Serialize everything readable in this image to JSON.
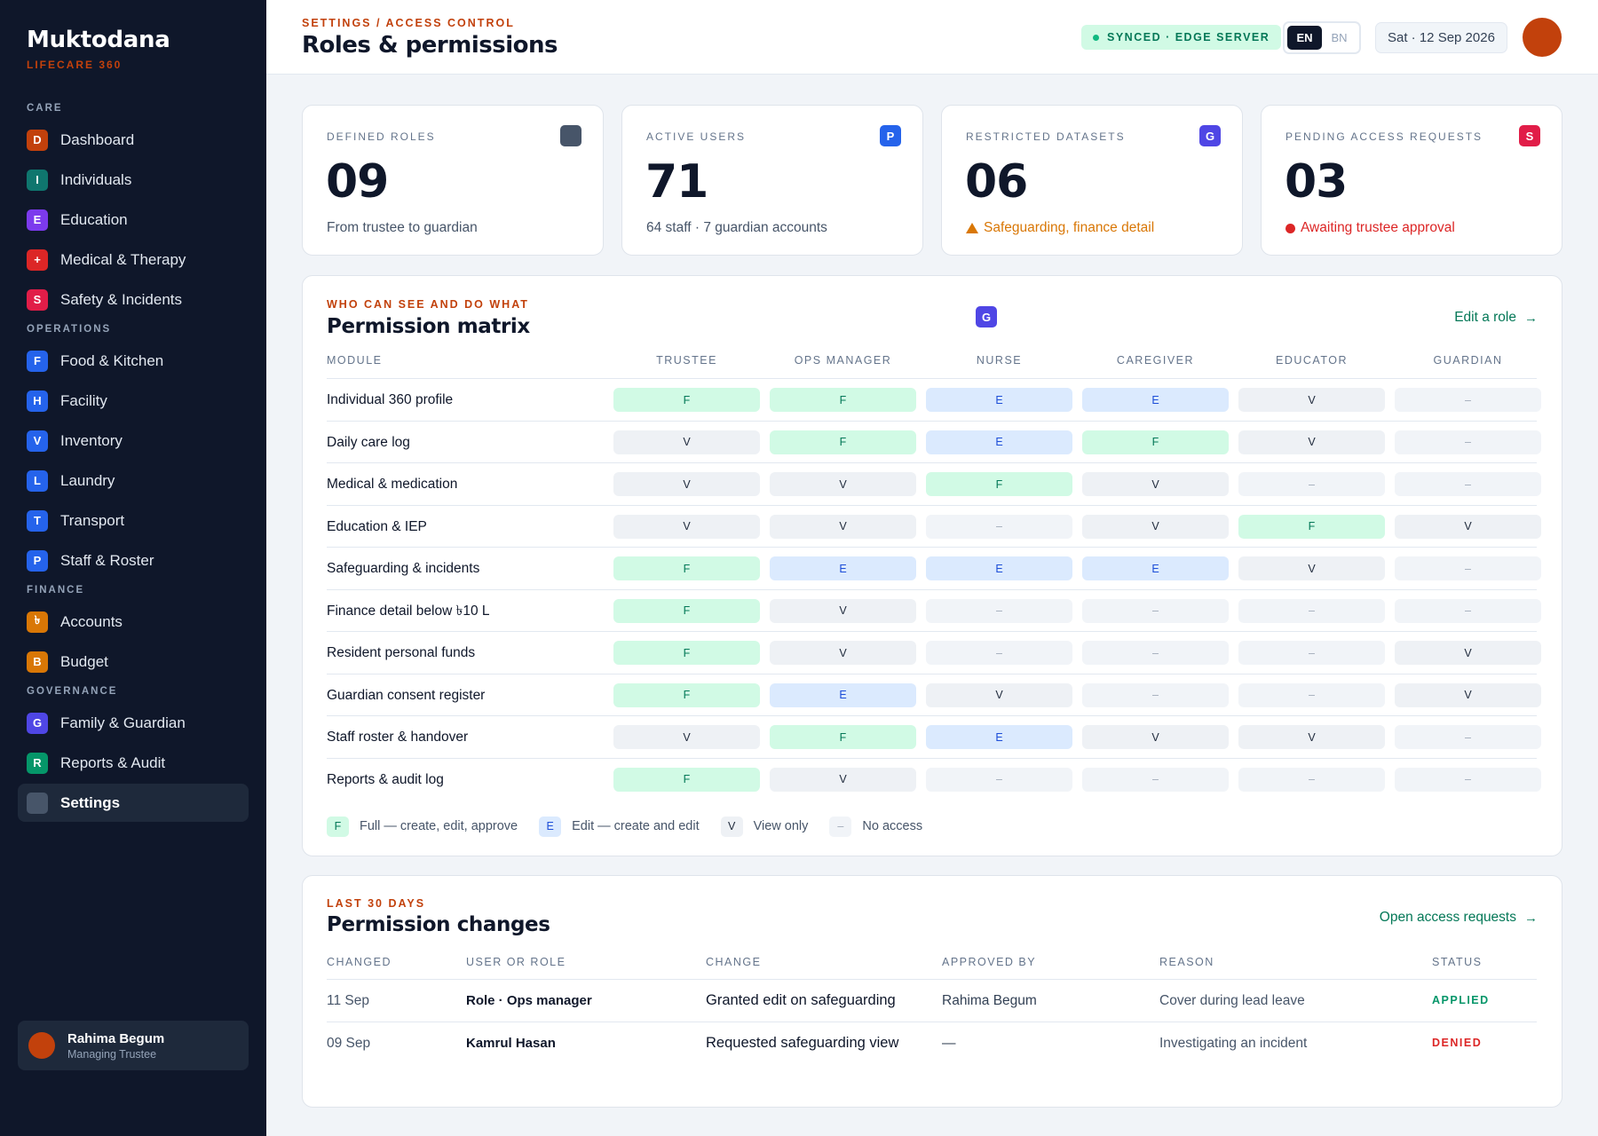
{
  "brand": {
    "name": "Muktodana",
    "subtitle": "LIFECARE 360"
  },
  "sidebar": {
    "sections": [
      {
        "label": "CARE",
        "items": [
          {
            "letter": "D",
            "label": "Dashboard",
            "color": "#c2410c"
          },
          {
            "letter": "I",
            "label": "Individuals",
            "color": "#0f766e"
          },
          {
            "letter": "E",
            "label": "Education",
            "color": "#7c3aed"
          },
          {
            "letter": "+",
            "label": "Medical & Therapy",
            "color": "#dc2626"
          },
          {
            "letter": "S",
            "label": "Safety & Incidents",
            "color": "#e11d48"
          }
        ]
      },
      {
        "label": "OPERATIONS",
        "items": [
          {
            "letter": "F",
            "label": "Food & Kitchen",
            "color": "#2563eb"
          },
          {
            "letter": "H",
            "label": "Facility",
            "color": "#2563eb"
          },
          {
            "letter": "V",
            "label": "Inventory",
            "color": "#2563eb"
          },
          {
            "letter": "L",
            "label": "Laundry",
            "color": "#2563eb"
          },
          {
            "letter": "T",
            "label": "Transport",
            "color": "#2563eb"
          },
          {
            "letter": "P",
            "label": "Staff & Roster",
            "color": "#2563eb"
          }
        ]
      },
      {
        "label": "FINANCE",
        "items": [
          {
            "letter": "৳",
            "label": "Accounts",
            "color": "#d97706"
          },
          {
            "letter": "B",
            "label": "Budget",
            "color": "#d97706"
          }
        ]
      },
      {
        "label": "GOVERNANCE",
        "items": [
          {
            "letter": "G",
            "label": "Family & Guardian",
            "color": "#4f46e5"
          },
          {
            "letter": "R",
            "label": "Reports & Audit",
            "color": "#059669"
          },
          {
            "letter": "",
            "label": "Settings",
            "color": "#475569",
            "active": true
          }
        ]
      }
    ],
    "user": {
      "name": "Rahima Begum",
      "role": "Managing Trustee"
    }
  },
  "header": {
    "breadcrumb": "SETTINGS / ACCESS CONTROL",
    "title": "Roles & permissions",
    "sync_status": "SYNCED · EDGE SERVER",
    "languages": [
      "EN",
      "BN"
    ],
    "active_language": "EN",
    "date": "Sat · 12 Sep 2026"
  },
  "stats": [
    {
      "label": "DEFINED ROLES",
      "value": "09",
      "note": "From trustee to guardian",
      "badge": "",
      "badge_color": "#475569",
      "note_type": "plain"
    },
    {
      "label": "ACTIVE USERS",
      "value": "71",
      "note": "64 staff · 7 guardian accounts",
      "badge": "P",
      "badge_color": "#2563eb",
      "note_type": "plain"
    },
    {
      "label": "RESTRICTED DATASETS",
      "value": "06",
      "note": "Safeguarding, finance detail",
      "badge": "G",
      "badge_color": "#4f46e5",
      "note_type": "warn"
    },
    {
      "label": "PENDING ACCESS REQUESTS",
      "value": "03",
      "note": "Awaiting trustee approval",
      "badge": "S",
      "badge_color": "#e11d48",
      "note_type": "danger"
    }
  ],
  "matrix": {
    "eyebrow": "WHO CAN SEE AND DO WHAT",
    "title": "Permission matrix",
    "badge": "G",
    "link": "Edit a role",
    "module_header": "MODULE",
    "roles": [
      "TRUSTEE",
      "OPS MANAGER",
      "NURSE",
      "CAREGIVER",
      "EDUCATOR",
      "GUARDIAN"
    ],
    "rows": [
      {
        "module": "Individual 360 profile",
        "cells": [
          "F",
          "F",
          "E",
          "E",
          "V",
          "–"
        ]
      },
      {
        "module": "Daily care log",
        "cells": [
          "V",
          "F",
          "E",
          "F",
          "V",
          "–"
        ]
      },
      {
        "module": "Medical & medication",
        "cells": [
          "V",
          "V",
          "F",
          "V",
          "–",
          "–"
        ]
      },
      {
        "module": "Education & IEP",
        "cells": [
          "V",
          "V",
          "–",
          "V",
          "F",
          "V"
        ]
      },
      {
        "module": "Safeguarding & incidents",
        "cells": [
          "F",
          "E",
          "E",
          "E",
          "V",
          "–"
        ]
      },
      {
        "module": "Finance detail below ৳10 L",
        "cells": [
          "F",
          "V",
          "–",
          "–",
          "–",
          "–"
        ]
      },
      {
        "module": "Resident personal funds",
        "cells": [
          "F",
          "V",
          "–",
          "–",
          "–",
          "V"
        ]
      },
      {
        "module": "Guardian consent register",
        "cells": [
          "F",
          "E",
          "V",
          "–",
          "–",
          "V"
        ]
      },
      {
        "module": "Staff roster & handover",
        "cells": [
          "V",
          "F",
          "E",
          "V",
          "V",
          "–"
        ]
      },
      {
        "module": "Reports & audit log",
        "cells": [
          "F",
          "V",
          "–",
          "–",
          "–",
          "–"
        ]
      }
    ],
    "legend": [
      {
        "code": "F",
        "text": "Full — create, edit, approve"
      },
      {
        "code": "E",
        "text": "Edit — create and edit"
      },
      {
        "code": "V",
        "text": "View only"
      },
      {
        "code": "–",
        "text": "No access"
      }
    ]
  },
  "changes": {
    "eyebrow": "LAST 30 DAYS",
    "title": "Permission changes",
    "link": "Open access requests",
    "headers": [
      "CHANGED",
      "USER OR ROLE",
      "CHANGE",
      "APPROVED BY",
      "REASON",
      "STATUS"
    ],
    "rows": [
      {
        "date": "11 Sep",
        "user": "Role · Ops manager",
        "change": "Granted edit on safeguarding",
        "approved_by": "Rahima Begum",
        "reason": "Cover during lead leave",
        "status": "APPLIED",
        "status_color": "#059669"
      },
      {
        "date": "09 Sep",
        "user": "Kamrul Hasan",
        "change": "Requested safeguarding view",
        "approved_by": "—",
        "reason": "Investigating an incident",
        "status": "DENIED",
        "status_color": "#dc2626"
      }
    ]
  }
}
